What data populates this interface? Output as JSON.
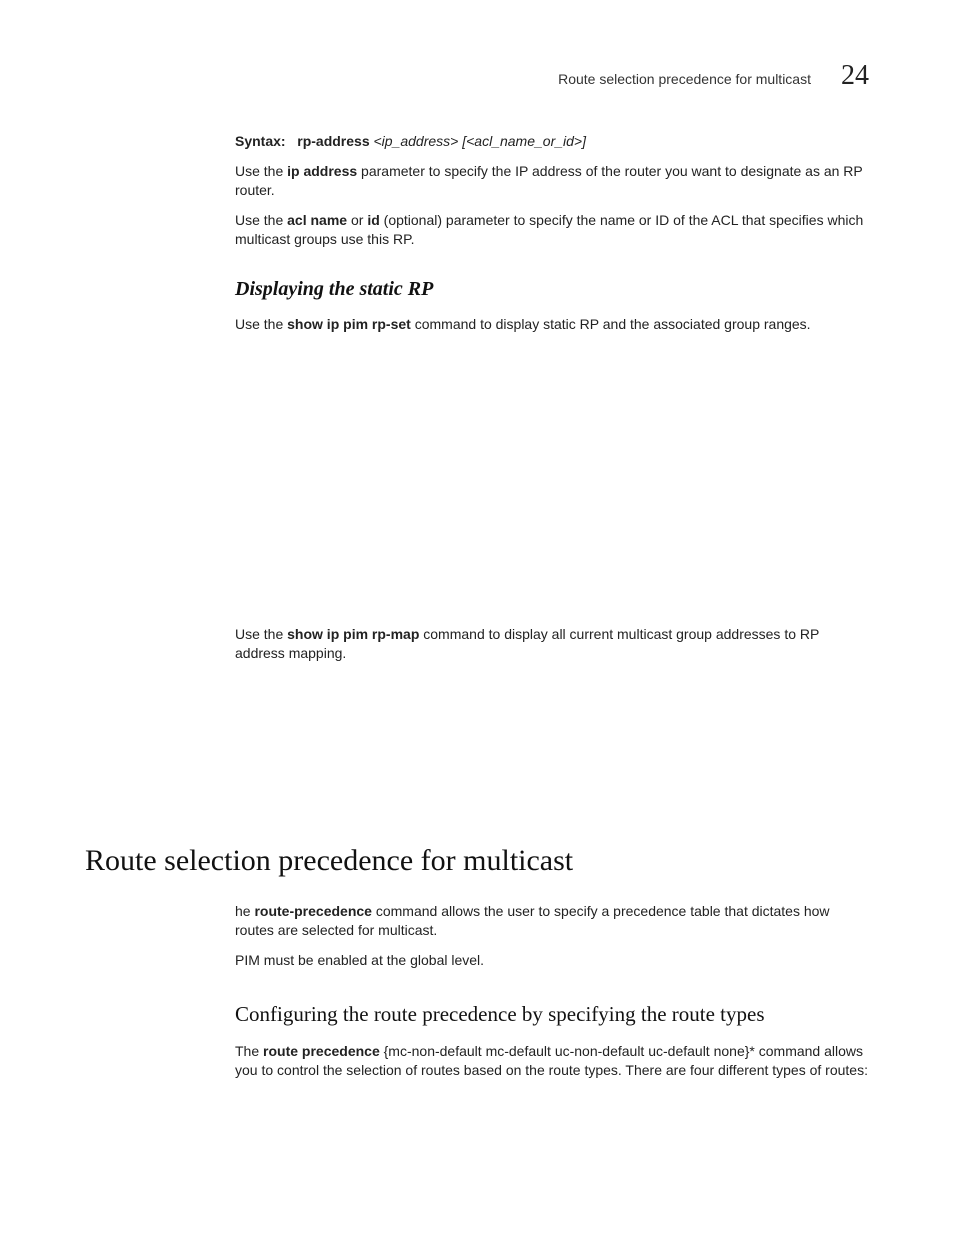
{
  "header": {
    "title": "Route selection precedence for multicast",
    "chapter": "24"
  },
  "syntax": {
    "label": "Syntax:",
    "command": "rp-address",
    "args": "<ip_address> [<acl_name_or_id>]"
  },
  "para_ip": {
    "pre": "Use the ",
    "bold": "ip address",
    "post": " parameter to specify the IP address of the router you want to designate as an RP router."
  },
  "para_acl": {
    "pre": "Use the ",
    "bold1": "acl name",
    "mid1": " or ",
    "bold2": "id",
    "post": " (optional) parameter to specify the name or ID of the ACL that specifies which multicast groups use this RP."
  },
  "h3_static": "Displaying the static RP",
  "para_rpset": {
    "pre": "Use the ",
    "bold": "show ip pim rp-set",
    "post": " command to display static RP and the associated group ranges."
  },
  "para_rpmap": {
    "pre": "Use the ",
    "bold": "show ip pim rp-map",
    "post": " command to display all current multicast group addresses to RP address mapping."
  },
  "h1_main": "Route selection precedence for multicast",
  "para_routeprec": {
    "pre": "he ",
    "bold": "route-precedence",
    "post": " command allows the user to specify a precedence table that dictates how routes are selected for multicast."
  },
  "para_pim": "PIM must be enabled at the global level.",
  "h2_config": "Configuring the route precedence by specifying the route types",
  "para_routetypes": {
    "pre": "The ",
    "bold": "route precedence",
    "post": " {mc-non-default mc-default uc-non-default uc-default none}* command allows you to control the selection of routes based on the route types. There are four different types of routes:"
  }
}
